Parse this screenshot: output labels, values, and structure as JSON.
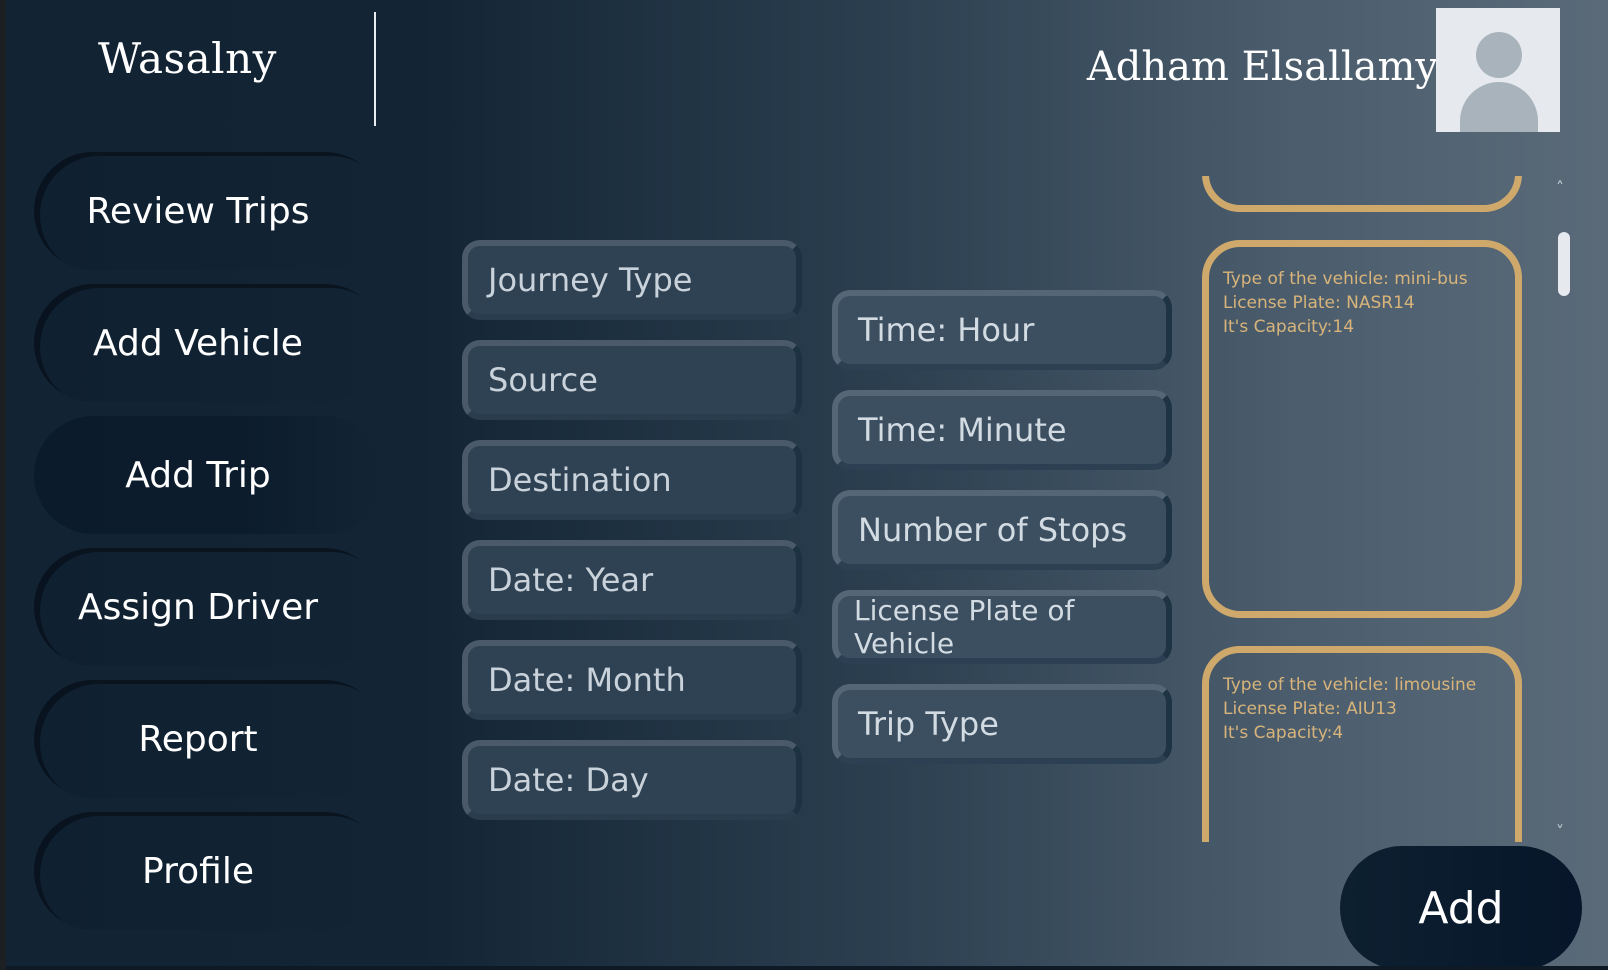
{
  "header": {
    "app_title": "Wasalny",
    "user_name": "Adham Elsallamy"
  },
  "sidebar": {
    "items": [
      {
        "label": "Review Trips"
      },
      {
        "label": "Add Vehicle"
      },
      {
        "label": "Add Trip",
        "active": true
      },
      {
        "label": "Assign Driver"
      },
      {
        "label": "Report"
      },
      {
        "label": "Profile"
      }
    ]
  },
  "form": {
    "left_fields": [
      {
        "placeholder": "Journey Type"
      },
      {
        "placeholder": "Source"
      },
      {
        "placeholder": "Destination"
      },
      {
        "placeholder": "Date: Year"
      },
      {
        "placeholder": "Date: Month"
      },
      {
        "placeholder": "Date: Day"
      }
    ],
    "right_fields": [
      {
        "placeholder": "Time: Hour"
      },
      {
        "placeholder": "Time: Minute"
      },
      {
        "placeholder": "Number of Stops"
      },
      {
        "placeholder": "License Plate of Vehicle"
      },
      {
        "placeholder": "Trip Type"
      }
    ]
  },
  "vehicles": [
    {
      "type_line": "Type of the vehicle: mini-bus",
      "plate_line": "License Plate: NASR14",
      "capacity_line": "It's Capacity:14"
    },
    {
      "type_line": "Type of the vehicle: limousine",
      "plate_line": "License Plate: AIU13",
      "capacity_line": "It's Capacity:4"
    }
  ],
  "scroll": {
    "up_glyph": "˄",
    "down_glyph": "˅"
  },
  "actions": {
    "add_label": "Add"
  },
  "colors": {
    "accent_card_border": "#cfa96c",
    "card_text": "#d8b47a",
    "sidebar_dark": "#0f2030"
  }
}
